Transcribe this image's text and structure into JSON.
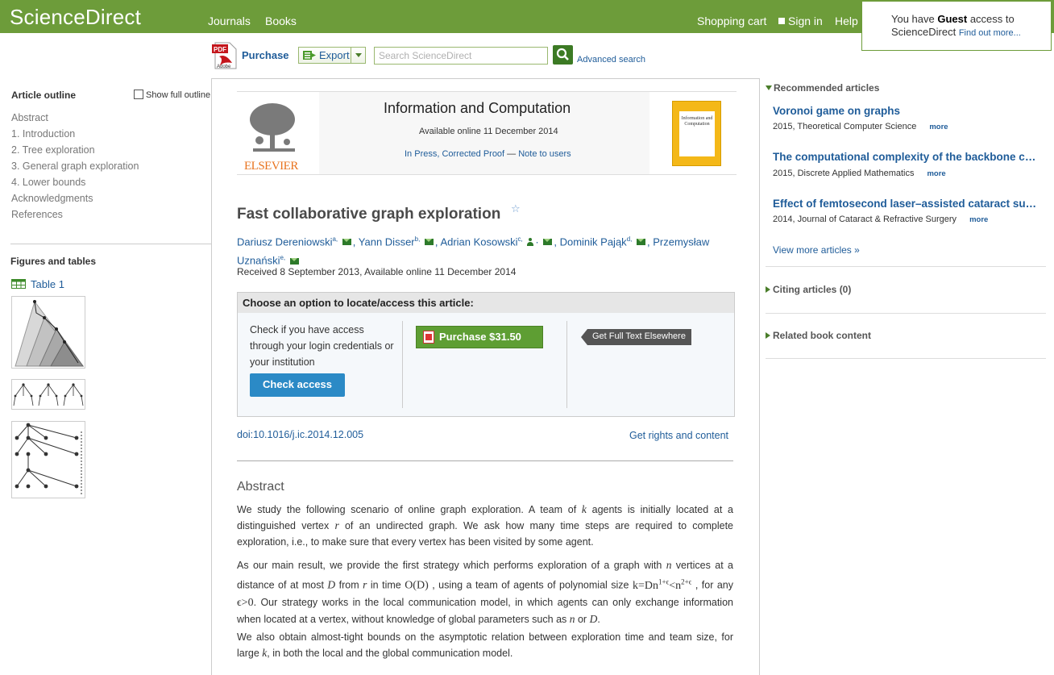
{
  "header": {
    "logo": "ScienceDirect",
    "nav": [
      "Journals",
      "Books"
    ],
    "shopping_cart": "Shopping cart",
    "sign_in": "Sign in",
    "help": "Help",
    "guest_prefix": "You have ",
    "guest_bold": "Guest",
    "guest_suffix": " access to",
    "guest_line2": "ScienceDirect ",
    "guest_link": "Find out more..."
  },
  "toolbar": {
    "purchase": "Purchase",
    "export": "Export",
    "search_placeholder": "Search ScienceDirect",
    "advanced_search": "Advanced search"
  },
  "outline": {
    "title": "Article outline",
    "show_full": "Show full outline",
    "items": [
      "Abstract",
      "1. Introduction",
      "2. Tree exploration",
      "3. General graph exploration",
      "4. Lower bounds",
      "Acknowledgments",
      "References"
    ]
  },
  "figures": {
    "title": "Figures and tables",
    "table_link": "Table 1"
  },
  "journal": {
    "title": "Information and Computation",
    "available": "Available online 11 December 2014",
    "in_press": "In Press, Corrected Proof",
    "dash": " — ",
    "note": "Note to users",
    "publisher": "ELSEVIER",
    "cover_text": "Information and Computation"
  },
  "article": {
    "title": "Fast collaborative graph exploration",
    "authors": [
      {
        "name": "Dariusz Dereniowski",
        "sup": "a,"
      },
      {
        "name": "Yann Disser",
        "sup": "b,"
      },
      {
        "name": "Adrian Kosowski",
        "sup": "c,"
      },
      {
        "name": "Dominik Pająk",
        "sup": "d,"
      },
      {
        "name": "Przemysław Uznański",
        "sup": "e,"
      }
    ],
    "received": "Received 8 September 2013, Available online 11 December 2014"
  },
  "access": {
    "heading": "Choose an option to locate/access this article:",
    "check_text": "Check if you have access through your login credentials or your institution",
    "check_button": "Check access",
    "purchase_button": "Purchase $31.50",
    "full_text_elsewhere": "Get Full Text Elsewhere"
  },
  "doi": "doi:10.1016/j.ic.2014.12.005",
  "rights": "Get rights and content",
  "abstract": {
    "heading": "Abstract",
    "p1": {
      "a": "We study the following scenario of online graph exploration. A team of ",
      "k": "k",
      "b": " agents is initially located at a distinguished vertex ",
      "r": "r",
      "c": " of an undirected graph. We ask how many time steps are required to complete exploration, i.e., to make sure that every vertex has been visited by some agent."
    },
    "p2": {
      "a": "As our main result, we provide the first strategy which performs exploration of a graph with ",
      "n": "n",
      "b": " vertices at a distance of at most ",
      "D": "D",
      "c": " from ",
      "r": "r",
      "d": "  in time ",
      "OD": "O(D)",
      "e": " , using a team of agents of polynomial size ",
      "kform": "k=Dn",
      "sup1": "1+ϵ",
      "lt": "<n",
      "sup2": "2+ϵ",
      "f": " , for any ",
      "eps": "ϵ>0",
      "g": ". Our strategy works in the local communication model, in which agents can only exchange information when located at a vertex, without knowledge of global parameters such as ",
      "n2": "n",
      "h": " or ",
      "D2": "D",
      "i": "."
    },
    "p3": {
      "a": "We also obtain almost-tight bounds on the asymptotic relation between exploration time and team size, for large ",
      "k": "k",
      "b": ", in both the local and the global communication model."
    }
  },
  "recommended": {
    "heading": "Recommended articles",
    "items": [
      {
        "title": "Voronoi game on graphs",
        "meta": "2015, Theoretical Computer Science",
        "more": "more"
      },
      {
        "title": "The computational complexity of the backbone coloring problem",
        "meta": "2015, Discrete Applied Mathematics",
        "more": "more"
      },
      {
        "title": "Effect of femtosecond laser–assisted cataract surgery",
        "meta": "2014, Journal of Cataract & Refractive Surgery",
        "more": "more"
      }
    ],
    "view_more": "View more articles »"
  },
  "citing": "Citing articles (0)",
  "related": "Related book content",
  "colors": {
    "brand_green": "#6d9c3a",
    "link_blue": "#1f5c99",
    "purchase_green": "#5e9e33",
    "check_access_blue": "#2b8ac6"
  }
}
